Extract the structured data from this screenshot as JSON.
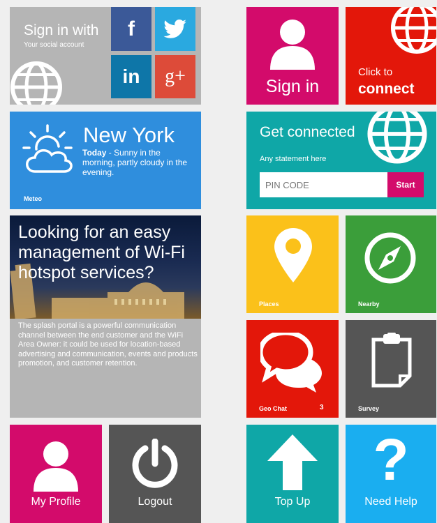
{
  "social": {
    "title": "Sign in with",
    "subtitle": "Your social account",
    "facebook_label": "f",
    "twitter_icon": "twitter-bird-icon",
    "linkedin_label": "in",
    "googleplus_label": "g+"
  },
  "signin": {
    "label": "Sign in"
  },
  "connect": {
    "pre": "Click to",
    "main": "connect"
  },
  "weather": {
    "city": "New York",
    "today_label": "Today",
    "forecast": " - Sunny in the morning, partly cloudy in the evening.",
    "footer": "Meteo"
  },
  "getconnected": {
    "title": "Get connected",
    "statement": "Any statement here",
    "pin_placeholder": "PIN CODE",
    "start_label": "Start"
  },
  "promo": {
    "headline": "Looking for an easy management of Wi-Fi hotspot services?",
    "body": "The splash portal is a powerful communication channel between the end customer and the WiFi Area Owner: it could be used for location-based advertising and communication, events and products promotion, and customer retention."
  },
  "places": {
    "label": "Places"
  },
  "nearby": {
    "label": "Nearby"
  },
  "geochat": {
    "label": "Geo Chat",
    "count": "3"
  },
  "survey": {
    "label": "Survey"
  },
  "profile": {
    "label": "My Profile"
  },
  "logout": {
    "label": "Logout"
  },
  "topup": {
    "label": "Top Up"
  },
  "help": {
    "label": "Need Help"
  },
  "colors": {
    "gray": "#b5b5b5",
    "magenta": "#d30b6b",
    "red": "#e3170a",
    "blue": "#2f8edd",
    "teal": "#0fa7a7",
    "yellow": "#fbc11a",
    "green": "#3b9e3a",
    "darkgray": "#555555",
    "facebook": "#3b5998",
    "twitter": "#2aa9e0",
    "linkedin": "#0e76a8",
    "googleplus": "#dd4b39",
    "skyblue": "#1aaef0"
  }
}
